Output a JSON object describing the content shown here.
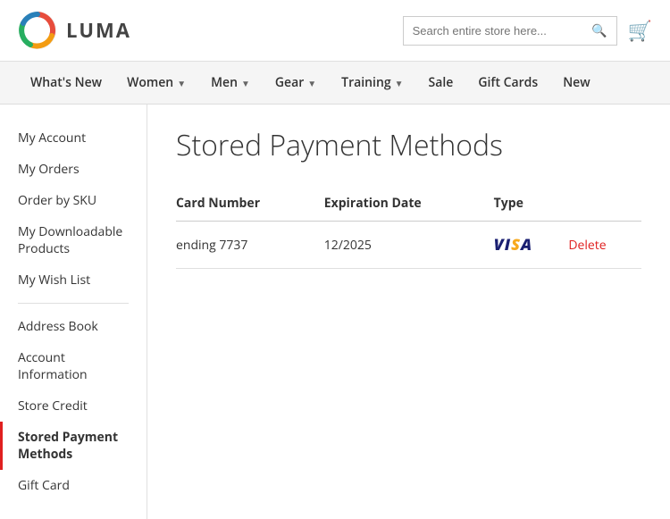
{
  "header": {
    "logo_text": "LUMA",
    "search_placeholder": "Search entire store here...",
    "cart_icon": "🛒"
  },
  "nav": {
    "items": [
      {
        "label": "What's New",
        "has_chevron": false
      },
      {
        "label": "Women",
        "has_chevron": true
      },
      {
        "label": "Men",
        "has_chevron": true
      },
      {
        "label": "Gear",
        "has_chevron": true
      },
      {
        "label": "Training",
        "has_chevron": true
      },
      {
        "label": "Sale",
        "has_chevron": false
      },
      {
        "label": "Gift Cards",
        "has_chevron": false
      },
      {
        "label": "New",
        "has_chevron": false
      }
    ]
  },
  "sidebar": {
    "items": [
      {
        "label": "My Account",
        "active": false
      },
      {
        "label": "My Orders",
        "active": false
      },
      {
        "label": "Order by SKU",
        "active": false
      },
      {
        "label": "My Downloadable Products",
        "active": false
      },
      {
        "label": "My Wish List",
        "active": false
      },
      {
        "label": "Address Book",
        "active": false
      },
      {
        "label": "Account Information",
        "active": false
      },
      {
        "label": "Store Credit",
        "active": false
      },
      {
        "label": "Stored Payment Methods",
        "active": true
      },
      {
        "label": "Gift Card",
        "active": false
      }
    ]
  },
  "page": {
    "title": "Stored Payment Methods",
    "table": {
      "headers": [
        "Card Number",
        "Expiration Date",
        "Type"
      ],
      "rows": [
        {
          "card_number": "ending 7737",
          "expiration_date": "12/2025",
          "type": "VISA",
          "delete_label": "Delete"
        }
      ]
    }
  }
}
